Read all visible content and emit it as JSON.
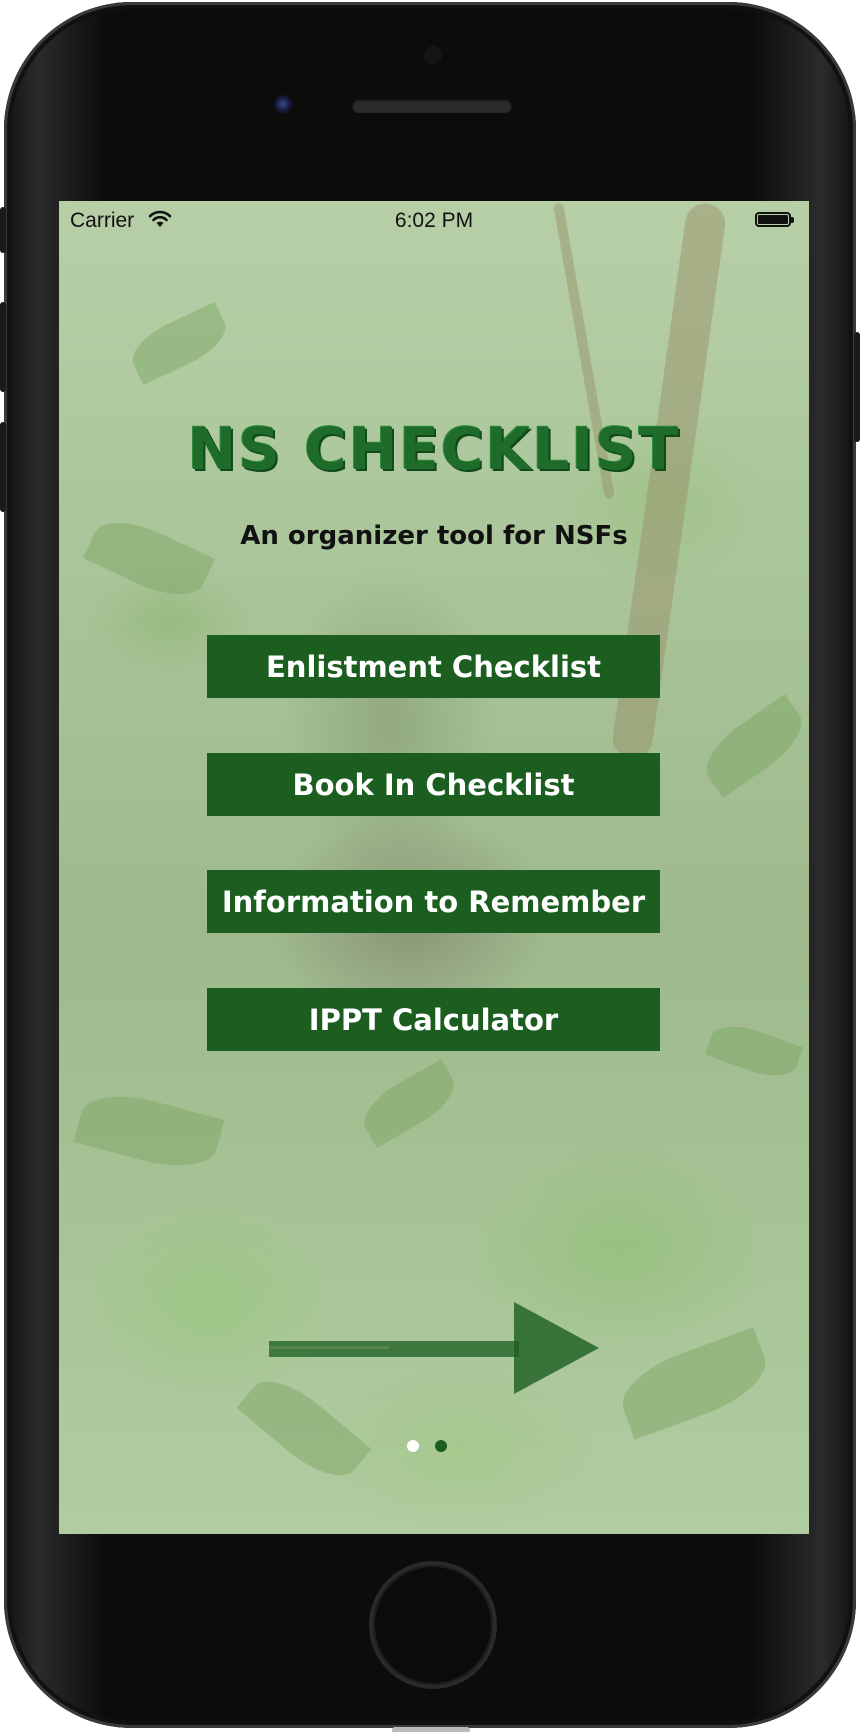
{
  "status_bar": {
    "carrier": "Carrier",
    "time": "6:02 PM",
    "wifi_icon": "wifi-icon",
    "battery_icon": "battery-icon"
  },
  "app": {
    "title": "NS CHECKLIST",
    "subtitle": "An organizer tool for NSFs"
  },
  "menu": {
    "buttons": [
      {
        "label": "Enlistment Checklist"
      },
      {
        "label": "Book In Checklist"
      },
      {
        "label": "Information to Remember"
      },
      {
        "label": "IPPT Calculator"
      }
    ]
  },
  "navigation": {
    "next_icon": "arrow-right-icon",
    "page_count": 2,
    "current_page": 1
  },
  "colors": {
    "accent": "#1b5e20",
    "title_green": "#1e6b2a",
    "button_text": "#ffffff",
    "dot_active": "#ffffff",
    "dot_inactive": "#1b5e20"
  }
}
